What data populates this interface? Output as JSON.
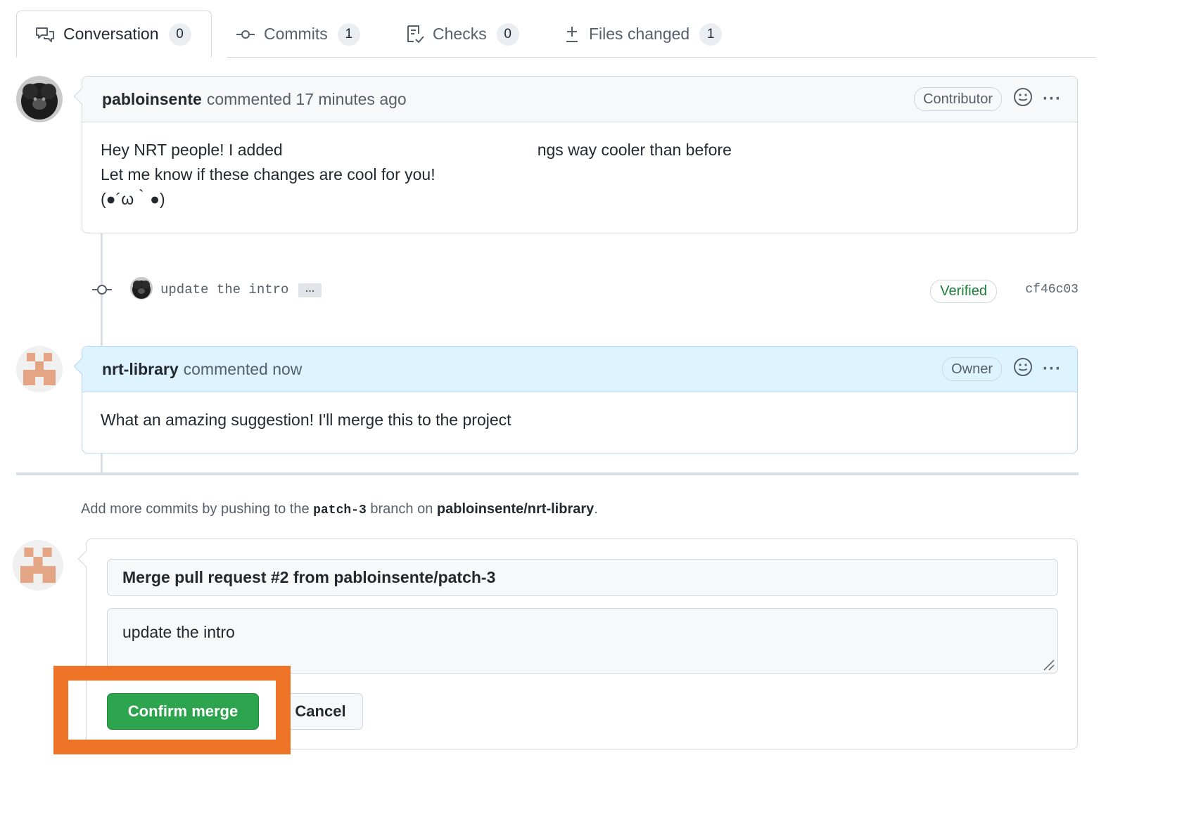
{
  "tabs": [
    {
      "label": "Conversation",
      "count": "0",
      "icon": "comment-discussion-icon"
    },
    {
      "label": "Commits",
      "count": "1",
      "icon": "git-commit-icon"
    },
    {
      "label": "Checks",
      "count": "0",
      "icon": "checklist-icon"
    },
    {
      "label": "Files changed",
      "count": "1",
      "icon": "file-diff-icon"
    }
  ],
  "comments": [
    {
      "author": "pabloinsente",
      "meta": "commented 17 minutes ago",
      "role": "Contributor",
      "lines": [
        "Hey NRT people! I added",
        "ngs way cooler than before",
        "Let me know if these changes are cool for you!",
        "(●´ω｀●)"
      ]
    },
    {
      "author": "nrt-library",
      "meta": "commented now",
      "role": "Owner",
      "lines": [
        "What an amazing suggestion! I'll merge this to the project"
      ]
    }
  ],
  "commit": {
    "message": "update the intro",
    "ellipsis": "…",
    "verified": "Verified",
    "sha": "cf46c03"
  },
  "hint": {
    "prefix": "Add more commits by pushing to the",
    "branch": "patch-3",
    "middle": "branch on",
    "repo": "pabloinsente/nrt-library",
    "suffix": "."
  },
  "merge": {
    "title_value": "Merge pull request #2 from pabloinsente/patch-3",
    "body_value": "update the intro",
    "confirm_label": "Confirm merge",
    "cancel_label": "Cancel"
  },
  "colors": {
    "confirm_green": "#2da44e",
    "highlight_orange": "#ed7326",
    "verified_green": "#1a7f37",
    "owner_header_blue": "#ddf4ff"
  }
}
